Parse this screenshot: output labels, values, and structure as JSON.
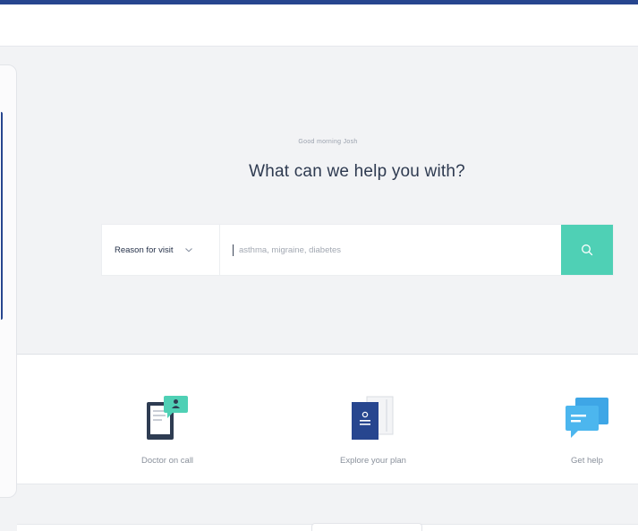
{
  "greeting": "Good morning Josh",
  "headline": "What can we help you with?",
  "search": {
    "reason_label": "Reason for visit",
    "placeholder": "asthma, migraine, diabetes",
    "value": "",
    "button_icon": "search-icon"
  },
  "actions": [
    {
      "label": "Doctor on call",
      "icon": "doctor-on-call-icon"
    },
    {
      "label": "Explore your plan",
      "icon": "plan-booklet-icon"
    },
    {
      "label": "Get help",
      "icon": "chat-bubbles-icon"
    }
  ],
  "colors": {
    "brand_navy": "#27468f",
    "accent_teal": "#4fd0b5",
    "help_blue": "#3ea6e6",
    "text_dark": "#2e3a50",
    "text_muted": "#8a919c"
  }
}
